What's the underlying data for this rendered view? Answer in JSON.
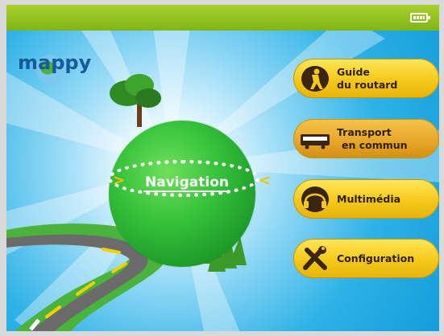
{
  "app": {
    "logo_text": "mappy"
  },
  "status": {
    "battery_icon": "battery-icon"
  },
  "center": {
    "chevron_left": ">",
    "chevron_right": "<",
    "label": "Navigation"
  },
  "menu": {
    "guide": {
      "line1": "Guide",
      "line2": "du routard",
      "icon": "backpacker-icon"
    },
    "transport": {
      "line1": "Transport",
      "line2": "en commun",
      "icon": "bus-icon"
    },
    "multimedia": {
      "line1": "Multimédia",
      "icon": "headphones-icon"
    },
    "config": {
      "line1": "Configuration",
      "icon": "tools-icon"
    }
  },
  "colors": {
    "topbar": "#8dc21d",
    "button": "#f5c81a",
    "globe": "#35c13a",
    "sky": "#2eb2e6"
  }
}
